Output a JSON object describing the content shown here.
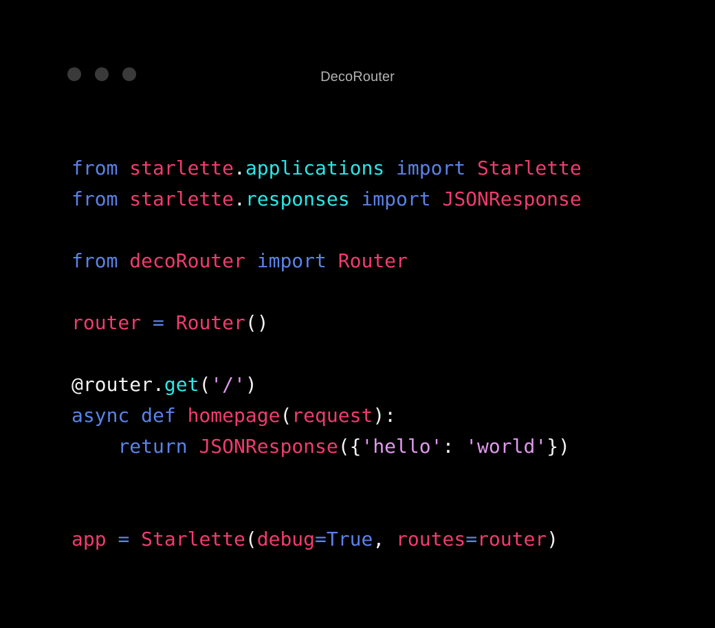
{
  "window": {
    "title": "DecoRouter",
    "background_color": "#000000",
    "traffic_lights": [
      {
        "name": "close",
        "color": "#3a3a3a"
      },
      {
        "name": "minimize",
        "color": "#3a3a3a"
      },
      {
        "name": "maximize",
        "color": "#3a3a3a"
      }
    ]
  },
  "theme": {
    "keyword_color": "#5a82e8",
    "identifier_color": "#f03c6e",
    "attribute_color": "#29e8e8",
    "string_color": "#e099ee",
    "punctuation_color": "#f2f2f2",
    "title_color": "#b2b2b2"
  },
  "code": {
    "language": "python",
    "plain_text": "from starlette.applications import Starlette\nfrom starlette.responses import JSONResponse\n\nfrom decoRouter import Router\n\nrouter = Router()\n\n@router.get('/')\nasync def homepage(request):\n    return JSONResponse({'hello': 'world'})\n\n\napp = Starlette(debug=True, routes=router)",
    "lines": [
      {
        "n": 1,
        "text": "from starlette.applications import Starlette",
        "tokens": [
          {
            "t": "from",
            "c": "kw"
          },
          {
            "t": " ",
            "c": "punc"
          },
          {
            "t": "starlette",
            "c": "name"
          },
          {
            "t": ".",
            "c": "punc"
          },
          {
            "t": "applications",
            "c": "attr"
          },
          {
            "t": " ",
            "c": "punc"
          },
          {
            "t": "import",
            "c": "kw"
          },
          {
            "t": " ",
            "c": "punc"
          },
          {
            "t": "Starlette",
            "c": "name"
          }
        ]
      },
      {
        "n": 2,
        "text": "from starlette.responses import JSONResponse",
        "tokens": [
          {
            "t": "from",
            "c": "kw"
          },
          {
            "t": " ",
            "c": "punc"
          },
          {
            "t": "starlette",
            "c": "name"
          },
          {
            "t": ".",
            "c": "punc"
          },
          {
            "t": "responses",
            "c": "attr"
          },
          {
            "t": " ",
            "c": "punc"
          },
          {
            "t": "import",
            "c": "kw"
          },
          {
            "t": " ",
            "c": "punc"
          },
          {
            "t": "JSONResponse",
            "c": "name"
          }
        ]
      },
      {
        "n": 3,
        "text": "",
        "tokens": []
      },
      {
        "n": 4,
        "text": "from decoRouter import Router",
        "tokens": [
          {
            "t": "from",
            "c": "kw"
          },
          {
            "t": " ",
            "c": "punc"
          },
          {
            "t": "decoRouter",
            "c": "name"
          },
          {
            "t": " ",
            "c": "punc"
          },
          {
            "t": "import",
            "c": "kw"
          },
          {
            "t": " ",
            "c": "punc"
          },
          {
            "t": "Router",
            "c": "name"
          }
        ]
      },
      {
        "n": 5,
        "text": "",
        "tokens": []
      },
      {
        "n": 6,
        "text": "router = Router()",
        "tokens": [
          {
            "t": "router",
            "c": "name"
          },
          {
            "t": " ",
            "c": "punc"
          },
          {
            "t": "=",
            "c": "kw"
          },
          {
            "t": " ",
            "c": "punc"
          },
          {
            "t": "Router",
            "c": "name"
          },
          {
            "t": "()",
            "c": "punc"
          }
        ]
      },
      {
        "n": 7,
        "text": "",
        "tokens": []
      },
      {
        "n": 8,
        "text": "@router.get('/')",
        "tokens": [
          {
            "t": "@router.",
            "c": "punc"
          },
          {
            "t": "get",
            "c": "attr"
          },
          {
            "t": "(",
            "c": "punc"
          },
          {
            "t": "'/'",
            "c": "str"
          },
          {
            "t": ")",
            "c": "punc"
          }
        ]
      },
      {
        "n": 9,
        "text": "async def homepage(request):",
        "tokens": [
          {
            "t": "async def",
            "c": "kw"
          },
          {
            "t": " ",
            "c": "punc"
          },
          {
            "t": "homepage",
            "c": "name"
          },
          {
            "t": "(",
            "c": "punc"
          },
          {
            "t": "request",
            "c": "name"
          },
          {
            "t": "):",
            "c": "punc"
          }
        ]
      },
      {
        "n": 10,
        "text": "    return JSONResponse({'hello': 'world'})",
        "tokens": [
          {
            "t": "    ",
            "c": "punc"
          },
          {
            "t": "return",
            "c": "kw"
          },
          {
            "t": " ",
            "c": "punc"
          },
          {
            "t": "JSONResponse",
            "c": "name"
          },
          {
            "t": "({",
            "c": "punc"
          },
          {
            "t": "'hello'",
            "c": "str"
          },
          {
            "t": ": ",
            "c": "punc"
          },
          {
            "t": "'world'",
            "c": "str"
          },
          {
            "t": "})",
            "c": "punc"
          }
        ]
      },
      {
        "n": 11,
        "text": "",
        "tokens": []
      },
      {
        "n": 12,
        "text": "",
        "tokens": []
      },
      {
        "n": 13,
        "text": "app = Starlette(debug=True, routes=router)",
        "tokens": [
          {
            "t": "app",
            "c": "name"
          },
          {
            "t": " ",
            "c": "punc"
          },
          {
            "t": "=",
            "c": "kw"
          },
          {
            "t": " ",
            "c": "punc"
          },
          {
            "t": "Starlette",
            "c": "name"
          },
          {
            "t": "(",
            "c": "punc"
          },
          {
            "t": "debug",
            "c": "name"
          },
          {
            "t": "=",
            "c": "kw"
          },
          {
            "t": "True",
            "c": "kw"
          },
          {
            "t": ", ",
            "c": "punc"
          },
          {
            "t": "routes",
            "c": "name"
          },
          {
            "t": "=",
            "c": "kw"
          },
          {
            "t": "router",
            "c": "name"
          },
          {
            "t": ")",
            "c": "punc"
          }
        ]
      }
    ]
  }
}
